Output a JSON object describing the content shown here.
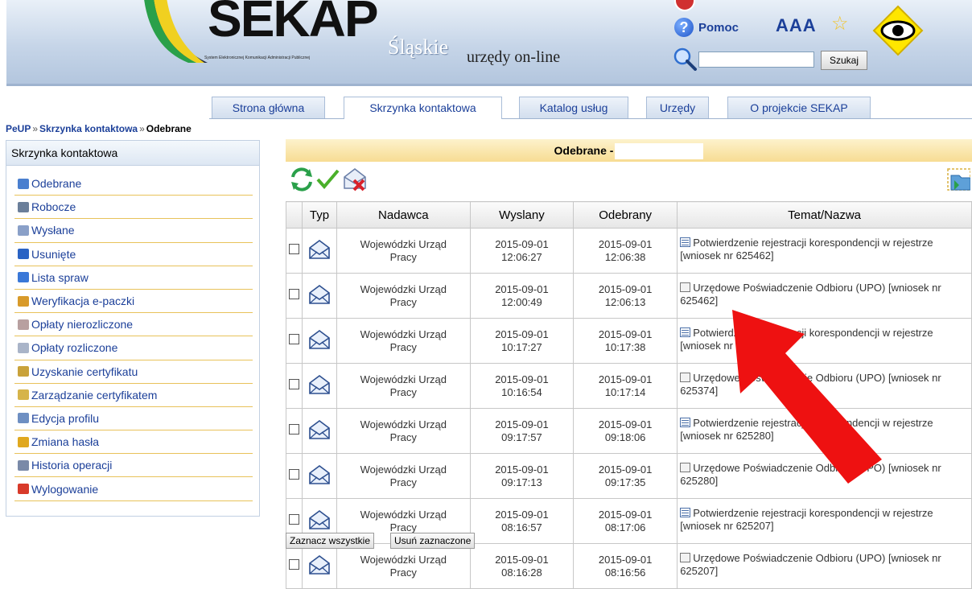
{
  "header": {
    "logo_text": "SEKAP",
    "logo_subtitle": "System Elektronicznej Komunikacji Administracji Publicznej",
    "region": "Śląskie",
    "tagline": "urzędy on-line",
    "help_label": "Pomoc",
    "font_size_label": "AAA",
    "search_placeholder": "",
    "search_button": "Szukaj"
  },
  "tabs": [
    {
      "label": "Strona główna"
    },
    {
      "label": "Skrzynka kontaktowa",
      "active": true
    },
    {
      "label": "Katalog usług"
    },
    {
      "label": "Urzędy"
    },
    {
      "label": "O projekcie SEKAP"
    }
  ],
  "breadcrumb": {
    "items": [
      "PeUP",
      "Skrzynka kontaktowa",
      "Odebrane"
    ],
    "separator": "»"
  },
  "sidebar": {
    "title": "Skrzynka kontaktowa",
    "items": [
      {
        "label": "Odebrane",
        "icon": "inbox-icon",
        "color": "#4a7fcf"
      },
      {
        "label": "Robocze",
        "icon": "draft-icon",
        "color": "#6b7f9a"
      },
      {
        "label": "Wysłane",
        "icon": "sent-icon",
        "color": "#8aa0c8"
      },
      {
        "label": "Usunięte",
        "icon": "trash-icon",
        "color": "#2a63c4"
      },
      {
        "label": "Lista spraw",
        "icon": "case-list-icon",
        "color": "#3a78d8"
      },
      {
        "label": "Weryfikacja e-paczki",
        "icon": "package-icon",
        "color": "#d89a2a"
      },
      {
        "label": "Opłaty nierozliczone",
        "icon": "payment-icon",
        "color": "#b8a0a0"
      },
      {
        "label": "Opłaty rozliczone",
        "icon": "payment-settled-icon",
        "color": "#a9b4c8"
      },
      {
        "label": "Uzyskanie certyfikatu",
        "icon": "certificate-icon",
        "color": "#c9a23a"
      },
      {
        "label": "Zarządzanie certyfikatem",
        "icon": "certificate-manage-icon",
        "color": "#d6b44a"
      },
      {
        "label": "Edycja profilu",
        "icon": "profile-icon",
        "color": "#6e8fc2"
      },
      {
        "label": "Zmiana hasła",
        "icon": "key-icon",
        "color": "#e0a81f"
      },
      {
        "label": "Historia operacji",
        "icon": "history-icon",
        "color": "#7a8aa8"
      },
      {
        "label": "Wylogowanie",
        "icon": "logout-icon",
        "color": "#d83a2a"
      }
    ]
  },
  "main": {
    "title": "Odebrane -",
    "columns": [
      "",
      "Typ",
      "Nadawca",
      "Wyslany",
      "Odebrany",
      "Temat/Nazwa"
    ],
    "rows": [
      {
        "sender_line1": "Wojewódzki Urząd",
        "sender_line2": "Pracy",
        "sent_date": "2015-09-01",
        "sent_time": "12:06:27",
        "recv_date": "2015-09-01",
        "recv_time": "12:06:38",
        "subject_line1": "Potwierdzenie rejestracji korespondencji w rejestrze",
        "subject_line2": "[wniosek nr 625462]",
        "kind": "reg"
      },
      {
        "sender_line1": "Wojewódzki Urząd",
        "sender_line2": "Pracy",
        "sent_date": "2015-09-01",
        "sent_time": "12:00:49",
        "recv_date": "2015-09-01",
        "recv_time": "12:06:13",
        "subject_line1": "Urzędowe Poświadczenie Odbioru (UPO) [wniosek nr",
        "subject_line2": "625462]",
        "kind": "upo"
      },
      {
        "sender_line1": "Wojewódzki Urząd",
        "sender_line2": "Pracy",
        "sent_date": "2015-09-01",
        "sent_time": "10:17:27",
        "recv_date": "2015-09-01",
        "recv_time": "10:17:38",
        "subject_line1": "Potwierdzenie rejestracji korespondencji w rejestrze",
        "subject_line2": "[wniosek nr 625374]",
        "kind": "reg"
      },
      {
        "sender_line1": "Wojewódzki Urząd",
        "sender_line2": "Pracy",
        "sent_date": "2015-09-01",
        "sent_time": "10:16:54",
        "recv_date": "2015-09-01",
        "recv_time": "10:17:14",
        "subject_line1": "Urzędowe Poświadczenie Odbioru (UPO) [wniosek nr",
        "subject_line2": "625374]",
        "kind": "upo"
      },
      {
        "sender_line1": "Wojewódzki Urząd",
        "sender_line2": "Pracy",
        "sent_date": "2015-09-01",
        "sent_time": "09:17:57",
        "recv_date": "2015-09-01",
        "recv_time": "09:18:06",
        "subject_line1": "Potwierdzenie rejestracji korespondencji w rejestrze",
        "subject_line2": "[wniosek nr 625280]",
        "kind": "reg"
      },
      {
        "sender_line1": "Wojewódzki Urząd",
        "sender_line2": "Pracy",
        "sent_date": "2015-09-01",
        "sent_time": "09:17:13",
        "recv_date": "2015-09-01",
        "recv_time": "09:17:35",
        "subject_line1": "Urzędowe Poświadczenie Odbioru (UPO) [wniosek nr",
        "subject_line2": "625280]",
        "kind": "upo"
      },
      {
        "sender_line1": "Wojewódzki Urząd",
        "sender_line2": "Pracy",
        "sent_date": "2015-09-01",
        "sent_time": "08:16:57",
        "recv_date": "2015-09-01",
        "recv_time": "08:17:06",
        "subject_line1": "Potwierdzenie rejestracji korespondencji w rejestrze",
        "subject_line2": "[wniosek nr 625207]",
        "kind": "reg"
      },
      {
        "sender_line1": "Wojewódzki Urząd",
        "sender_line2": "Pracy",
        "sent_date": "2015-09-01",
        "sent_time": "08:16:28",
        "recv_date": "2015-09-01",
        "recv_time": "08:16:56",
        "subject_line1": "Urzędowe Poświadczenie Odbioru (UPO) [wniosek nr",
        "subject_line2": "625207]",
        "kind": "upo"
      }
    ],
    "select_all_label": "Zaznacz wszystkie",
    "delete_selected_label": "Usuń zaznaczone"
  },
  "colors": {
    "link": "#1b3f99",
    "title_bar": "#f7dc93",
    "sidebar_separator": "#e8c25a",
    "arrow": "#ee1111"
  }
}
